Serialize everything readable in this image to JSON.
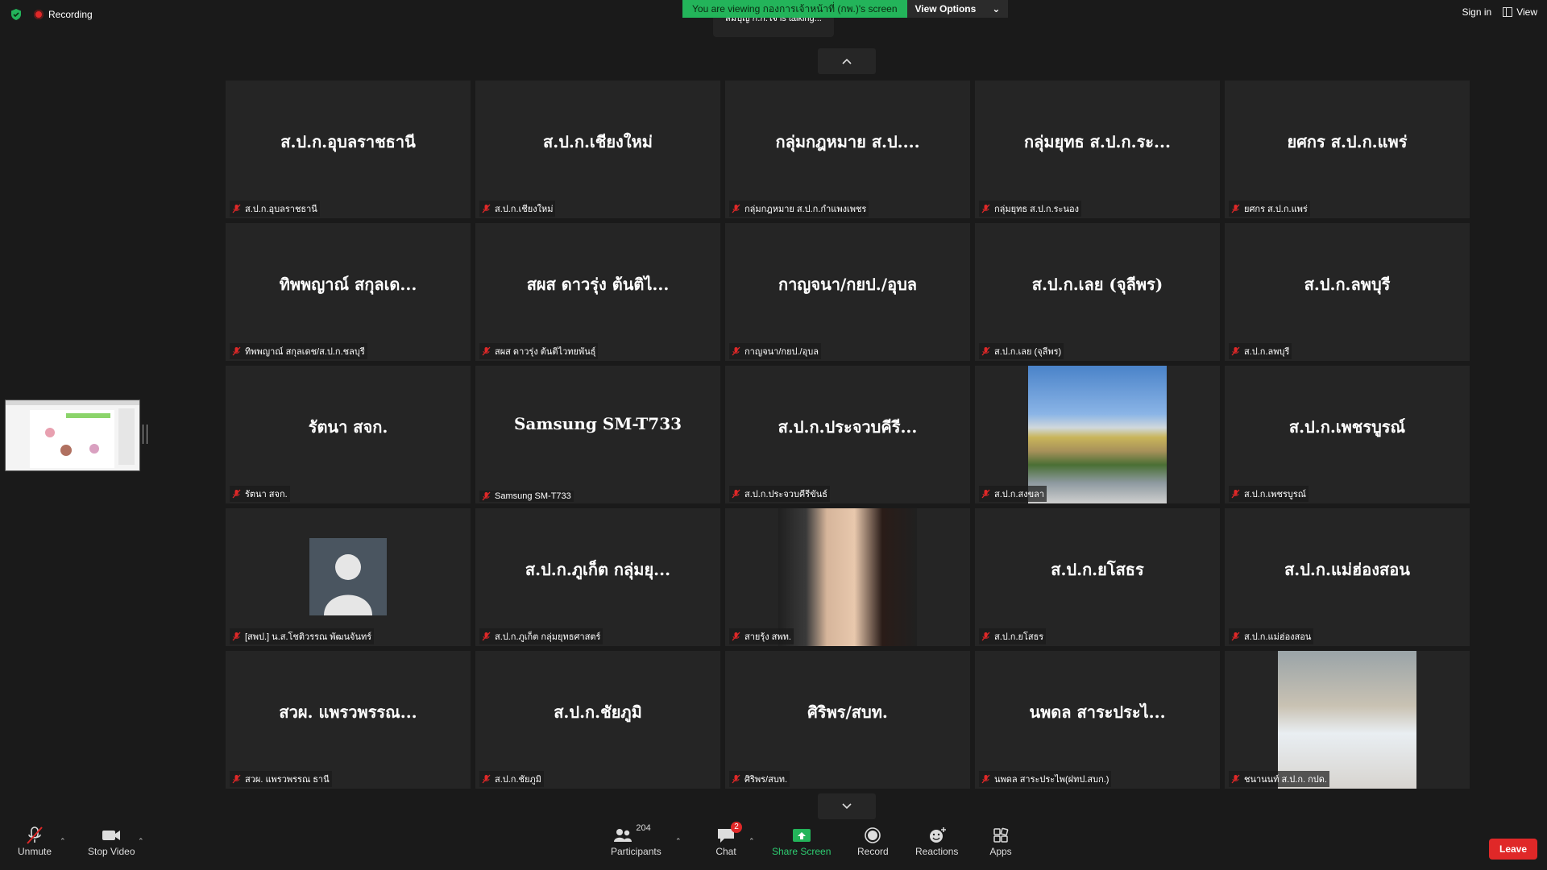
{
  "top_bar": {
    "recording_label": "Recording",
    "banner_text": "You are viewing กองการเจ้าหน้าที่ (กพ.)'s screen",
    "view_options_label": "View Options",
    "talking_text": "สมบุญ ก.ก.ใจ is talking...",
    "sign_in_label": "Sign in",
    "view_label": "View"
  },
  "tiles": [
    {
      "title": "ส.ป.ก.อุบลราชธานี",
      "label": "ส.ป.ก.อุบลราชธานี",
      "media": "name"
    },
    {
      "title": "ส.ป.ก.เชียงใหม่",
      "label": "ส.ป.ก.เชียงใหม่",
      "media": "name"
    },
    {
      "title": "กลุ่มกฎหมาย ส.ป....",
      "label": "กลุ่มกฎหมาย ส.ป.ก.กำแพงเพชร",
      "media": "name"
    },
    {
      "title": "กลุ่มยุทธ ส.ป.ก.ระ...",
      "label": "กลุ่มยุทธ ส.ป.ก.ระนอง",
      "media": "name"
    },
    {
      "title": "ยศกร ส.ป.ก.แพร่",
      "label": "ยศกร ส.ป.ก.แพร่",
      "media": "name"
    },
    {
      "title": "ทิพพญาณ์ สกุลเด...",
      "label": "ทิพพญาณ์ สกุลเดช/ส.ป.ก.ชลบุรี",
      "media": "name"
    },
    {
      "title": "สผส ดาวรุ่ง ต้นติไ...",
      "label": "สผส ดาวรุ่ง ต้นติไวทยพันธุ์",
      "media": "name"
    },
    {
      "title": "กาญจนา/กยป./อุบล",
      "label": "กาญจนา/กยป./อุบล",
      "media": "name"
    },
    {
      "title": "ส.ป.ก.เลย (จุลีพร)",
      "label": "ส.ป.ก.เลย (จุลีพร)",
      "media": "name"
    },
    {
      "title": "ส.ป.ก.ลพบุรี",
      "label": "ส.ป.ก.ลพบุรี",
      "media": "name"
    },
    {
      "title": "รัตนา สจก.",
      "label": "รัตนา สจก.",
      "media": "name"
    },
    {
      "title": "Samsung SM-T733",
      "label": "Samsung SM-T733",
      "media": "name"
    },
    {
      "title": "ส.ป.ก.ประจวบคีรี...",
      "label": "ส.ป.ก.ประจวบคีรีขันธ์",
      "media": "name"
    },
    {
      "title": "",
      "label": "ส.ป.ก.สงขลา",
      "media": "building-photo"
    },
    {
      "title": "ส.ป.ก.เพชรบูรณ์",
      "label": "ส.ป.ก.เพชรบูรณ์",
      "media": "name"
    },
    {
      "title": "",
      "label": "[สพป.] น.ส.โชติวรรณ พัฒนจันทร์",
      "media": "avatar"
    },
    {
      "title": "ส.ป.ก.ภูเก็ต กลุ่มยุ...",
      "label": "ส.ป.ก.ภูเก็ต กลุ่มยุทธศาสตร์",
      "media": "name"
    },
    {
      "title": "",
      "label": "สายรุ้ง สพท.",
      "media": "woman-video"
    },
    {
      "title": "ส.ป.ก.ยโสธร",
      "label": "ส.ป.ก.ยโสธร",
      "media": "name"
    },
    {
      "title": "ส.ป.ก.แม่ฮ่องสอน",
      "label": "ส.ป.ก.แม่ฮ่องสอน",
      "media": "name"
    },
    {
      "title": "สวผ. แพรวพรรณ...",
      "label": "สวผ. แพรวพรรณ ธานี",
      "media": "name"
    },
    {
      "title": "ส.ป.ก.ชัยภูมิ",
      "label": "ส.ป.ก.ชัยภูมิ",
      "media": "name"
    },
    {
      "title": "ศิริพร/สบท.",
      "label": "ศิริพร/สบท.",
      "media": "name"
    },
    {
      "title": "นพดล สาระประไ...",
      "label": "นพดล สาระประไพ(ฝทป.สบก.)",
      "media": "name"
    },
    {
      "title": "",
      "label": "ชนานนท์ ส.ป.ก. กปด.",
      "media": "man-video"
    }
  ],
  "toolbar": {
    "unmute_label": "Unmute",
    "stop_video_label": "Stop Video",
    "participants_label": "Participants",
    "participants_count": "204",
    "chat_label": "Chat",
    "chat_badge": "2",
    "share_screen_label": "Share Screen",
    "record_label": "Record",
    "reactions_label": "Reactions",
    "apps_label": "Apps",
    "leave_label": "Leave"
  },
  "colors": {
    "background": "#1a1a1a",
    "tile": "#252525",
    "banner_green": "#23b45a",
    "leave_red": "#e02828",
    "muted_red": "#e02828"
  }
}
